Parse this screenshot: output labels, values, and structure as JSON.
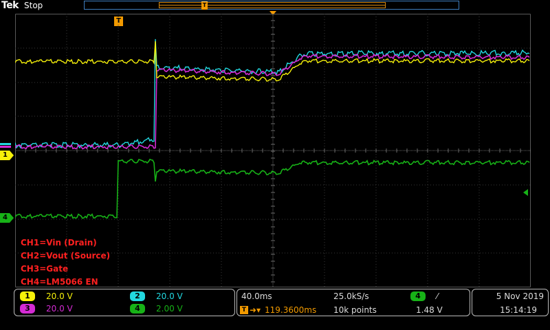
{
  "header": {
    "brand": "Tek",
    "state": "Stop",
    "trigger_tag": "T"
  },
  "colors": {
    "ch1": "#f6f10a",
    "ch2": "#22d8e0",
    "ch3": "#d42bd4",
    "ch4": "#17b217",
    "trigger": "#f29a00",
    "annotation": "#ff2020"
  },
  "channel_markers": {
    "ch1": "1",
    "ch4": "4"
  },
  "annotations": [
    "CH1=Vin (Drain)",
    "CH2=Vout (Source)",
    "CH3=Gate",
    "CH4=LM5066 EN"
  ],
  "channels": [
    {
      "id": "1",
      "scale": "20.0 V",
      "color": "#f6f10a"
    },
    {
      "id": "2",
      "scale": "20.0 V",
      "color": "#22d8e0"
    },
    {
      "id": "3",
      "scale": "20.0 V",
      "color": "#d42bd4"
    },
    {
      "id": "4",
      "scale": "2.00 V",
      "color": "#17b217"
    }
  ],
  "timebase": {
    "time_per_div": "40.0ms",
    "sample_rate": "25.0kS/s",
    "trigger_position": "119.3600ms",
    "record_length": "10k points",
    "trigger_source": "4",
    "trigger_slope": "⁄",
    "trigger_level": "1.48 V"
  },
  "datetime": {
    "date": "5 Nov 2019",
    "time": "15:14:19"
  },
  "icons": {
    "trigger_position": "orange-arrow-icon",
    "trigger_level": "green-left-arrow-icon"
  }
}
